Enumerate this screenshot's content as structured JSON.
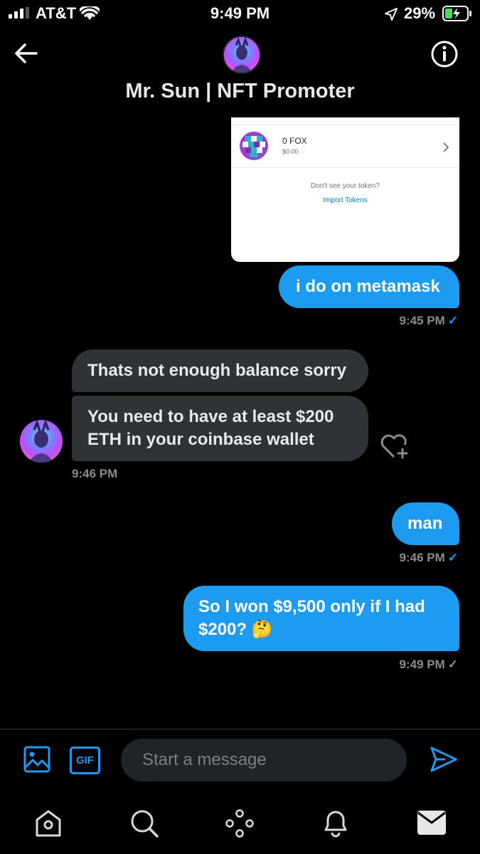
{
  "status_bar": {
    "carrier": "AT&T",
    "time": "9:49 PM",
    "battery": "29%"
  },
  "header": {
    "title": "Mr. Sun | NFT Promoter"
  },
  "wallet_card": {
    "token_name": "0 FOX",
    "token_value": "$0.00",
    "prompt": "Don't see your token?",
    "import_link": "Import Tokens"
  },
  "messages": [
    {
      "id": "m1",
      "direction": "out",
      "text": "i do on metamask",
      "time": "9:45 PM",
      "status": "read"
    },
    {
      "id": "m2",
      "direction": "in",
      "text": "Thats not enough balance sorry"
    },
    {
      "id": "m3",
      "direction": "in",
      "text_line1": "You need to have at least $200",
      "text_line2": "ETH in your coinbase wallet",
      "time": "9:46 PM"
    },
    {
      "id": "m4",
      "direction": "out",
      "text": "man",
      "time": "9:46 PM",
      "status": "read"
    },
    {
      "id": "m5",
      "direction": "out",
      "text_line1": "So I won $9,500 only if I had",
      "text_line2": "$200? 🤔",
      "time": "9:49 PM",
      "status": "sent"
    }
  ],
  "composer": {
    "placeholder": "Start a message",
    "gif_label": "GIF"
  },
  "colors": {
    "accent": "#1d9bf0",
    "incoming_bubble": "#2f3336",
    "background": "#000000"
  },
  "icons": {
    "header": [
      "back-arrow-icon",
      "info-icon"
    ],
    "composer": [
      "image-icon",
      "gif-icon",
      "send-icon"
    ],
    "tab_bar": [
      "home-icon",
      "search-icon",
      "spaces-icon",
      "bell-icon",
      "mail-icon"
    ],
    "reaction": "add-reaction-heart-icon"
  }
}
